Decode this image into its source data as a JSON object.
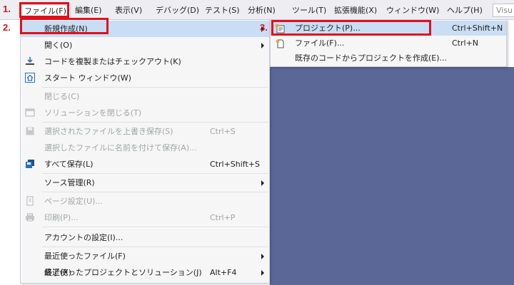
{
  "menubar": {
    "items": [
      {
        "label": "ファイル(F)"
      },
      {
        "label": "編集(E)"
      },
      {
        "label": "表示(V)"
      },
      {
        "label": "デバッグ(D)"
      },
      {
        "label": "テスト(S)"
      },
      {
        "label": "分析(N)"
      },
      {
        "label": "ツール(T)"
      },
      {
        "label": "拡張機能(X)"
      },
      {
        "label": "ウィンドウ(W)"
      },
      {
        "label": "ヘルプ(H)"
      }
    ],
    "search_text": "Visu"
  },
  "file_menu": {
    "items": [
      {
        "label": "新規作成(N)"
      },
      {
        "label": "開く(O)"
      },
      {
        "label": "コードを複製またはチェックアウト(K)"
      },
      {
        "label": "スタート ウィンドウ(W)"
      },
      {
        "label": "閉じる(C)"
      },
      {
        "label": "ソリューションを閉じる(T)"
      },
      {
        "label": "選択されたファイルを上書き保存(S)",
        "shortcut": "Ctrl+S"
      },
      {
        "label": "選択したファイルに名前を付けて保存(A)..."
      },
      {
        "label": "すべて保存(L)",
        "shortcut": "Ctrl+Shift+S"
      },
      {
        "label": "ソース管理(R)"
      },
      {
        "label": "ページ設定(U)..."
      },
      {
        "label": "印刷(P)...",
        "shortcut": "Ctrl+P"
      },
      {
        "label": "アカウントの設定(I)..."
      },
      {
        "label": "最近使ったファイル(F)"
      },
      {
        "label": "最近使ったプロジェクトとソリューション(J)"
      },
      {
        "label": "終了(X)",
        "shortcut": "Alt+F4"
      }
    ]
  },
  "submenu": {
    "items": [
      {
        "label": "プロジェクト(P)...",
        "shortcut": "Ctrl+Shift+N"
      },
      {
        "label": "ファイル(F)...",
        "shortcut": "Ctrl+N"
      },
      {
        "label": "既存のコードからプロジェクトを作成(E)..."
      }
    ]
  },
  "annotations": {
    "step1": "1.",
    "step2": "2.",
    "step3": "3."
  },
  "colors": {
    "annotation_red": "#e0101a",
    "editor_background": "#5b6796",
    "highlight": "#c9def5"
  }
}
